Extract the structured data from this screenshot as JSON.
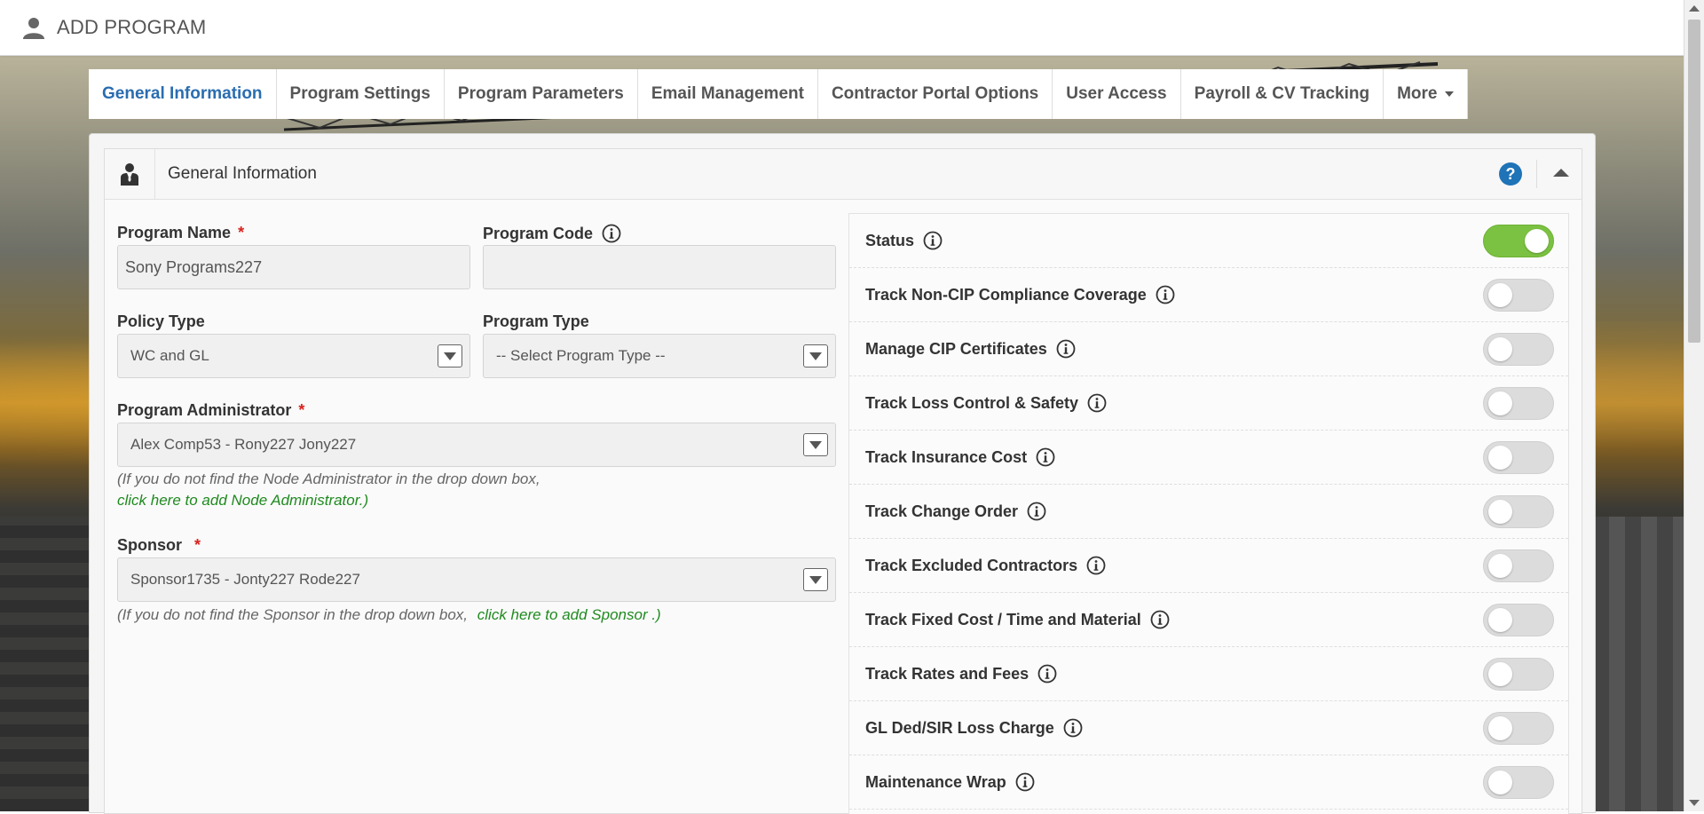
{
  "header": {
    "title": "ADD PROGRAM"
  },
  "tabs": [
    {
      "label": "General Information",
      "active": true
    },
    {
      "label": "Program Settings"
    },
    {
      "label": "Program Parameters"
    },
    {
      "label": "Email Management"
    },
    {
      "label": "Contractor Portal Options"
    },
    {
      "label": "User Access"
    },
    {
      "label": "Payroll & CV Tracking"
    },
    {
      "label": "More"
    }
  ],
  "panel": {
    "title": "General Information"
  },
  "form": {
    "program_name": {
      "label": "Program Name",
      "value": "Sony Programs227",
      "required": "*"
    },
    "program_code": {
      "label": "Program Code",
      "value": ""
    },
    "policy_type": {
      "label": "Policy Type",
      "value": "WC and GL"
    },
    "program_type": {
      "label": "Program Type",
      "value": "-- Select Program Type --"
    },
    "program_admin": {
      "label": "Program Administrator",
      "required": "*",
      "value": "Alex Comp53 - Rony227 Jony227",
      "note": "(If you do not find the Node Administrator in the drop down box,",
      "link": "click here to add Node Administrator.)"
    },
    "sponsor": {
      "label": "Sponsor",
      "required": "*",
      "value": "Sponsor1735 - Jonty227 Rode227",
      "note": "(If you do not find the Sponsor in the drop down box,",
      "link": "click here to add Sponsor .)"
    }
  },
  "toggles": [
    {
      "label": "Status",
      "on": true
    },
    {
      "label": "Track Non-CIP Compliance Coverage",
      "on": false
    },
    {
      "label": "Manage CIP Certificates",
      "on": false
    },
    {
      "label": "Track Loss Control & Safety",
      "on": false
    },
    {
      "label": "Track Insurance Cost",
      "on": false
    },
    {
      "label": "Track Change Order",
      "on": false
    },
    {
      "label": "Track Excluded Contractors",
      "on": false
    },
    {
      "label": "Track Fixed Cost / Time and Material",
      "on": false
    },
    {
      "label": "Track Rates and Fees",
      "on": false
    },
    {
      "label": "GL Ded/SIR Loss Charge",
      "on": false
    },
    {
      "label": "Maintenance Wrap",
      "on": false
    }
  ],
  "colors": {
    "accent": "#2a6db0",
    "toggle_on": "#7cc242",
    "required": "#d9231d",
    "link": "#1f8a1f"
  }
}
